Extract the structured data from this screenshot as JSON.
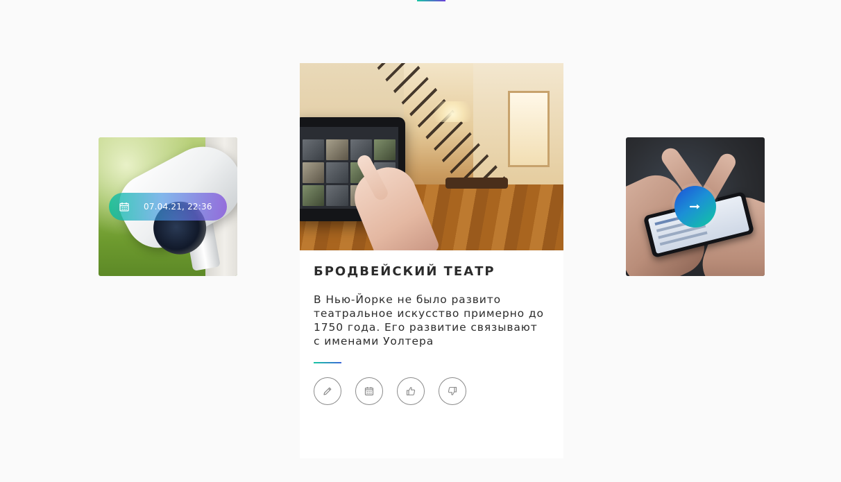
{
  "slider": {
    "left_card": {
      "image_alt": "security camera",
      "date": "07.04.21, 22:36",
      "calendar_icon": "calendar-icon"
    },
    "center_card": {
      "image_alt": "smart home tablet in living room",
      "title": "БРОДВЕЙСКИЙ ТЕАТР",
      "text": "В Нью-Йорке не было развито театральное искусство примерно до 1750 года. Его развитие связывают с именами Уолтера",
      "actions": [
        {
          "icon": "pencil-icon"
        },
        {
          "icon": "calendar-icon"
        },
        {
          "icon": "thumbs-up-icon"
        },
        {
          "icon": "thumbs-down-icon"
        }
      ]
    },
    "right_card": {
      "image_alt": "hands holding smartphone",
      "next_icon": "arrow-right-icon"
    }
  },
  "colors": {
    "accent_teal": "#17c6a3",
    "accent_blue": "#1d4fd8",
    "accent_purple": "#6a3fd9",
    "page_background": "#fafafa",
    "card_background": "#ffffff",
    "title_text": "#2b2b2b"
  }
}
